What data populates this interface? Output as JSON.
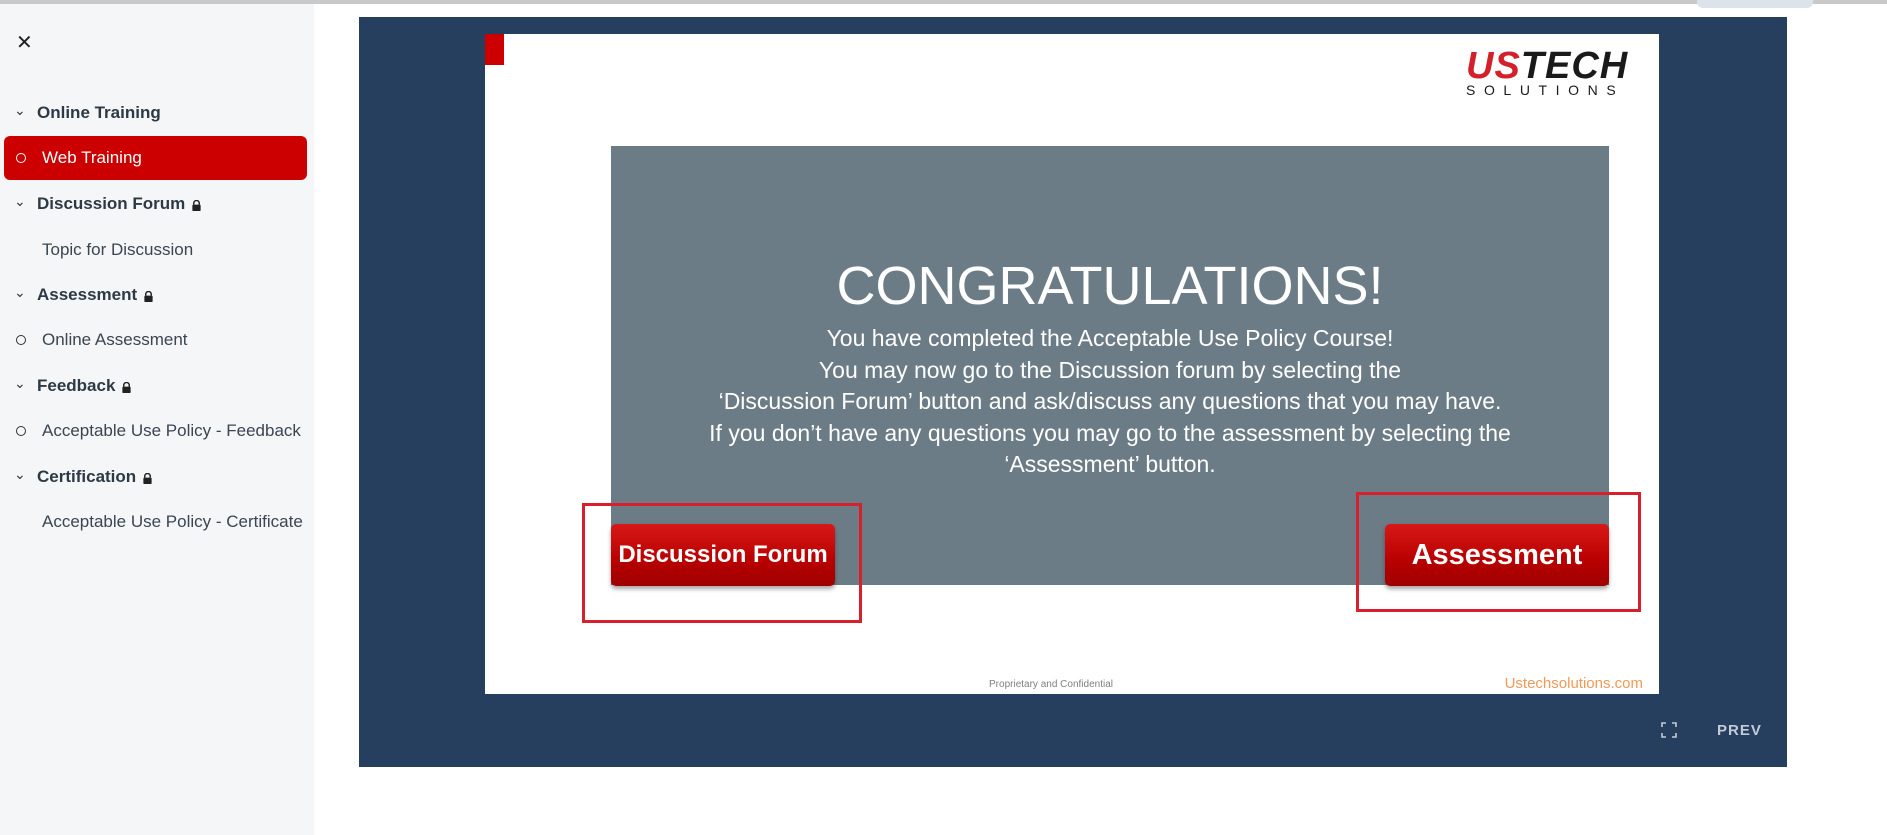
{
  "sidebar": {
    "close_glyph": "✕",
    "sections": [
      {
        "label": "Online Training",
        "locked": false
      },
      {
        "label": "Discussion Forum",
        "locked": true
      },
      {
        "label": "Assessment",
        "locked": true
      },
      {
        "label": "Feedback",
        "locked": true
      },
      {
        "label": "Certification",
        "locked": true
      }
    ],
    "items": [
      {
        "label": "Web Training",
        "active": true
      },
      {
        "label": "Topic for Discussion"
      },
      {
        "label": "Online Assessment"
      },
      {
        "label": "Acceptable Use Policy - Feedback"
      },
      {
        "label": "Acceptable Use Policy - Certificate"
      }
    ]
  },
  "slide": {
    "logo": {
      "us": "US",
      "tech": "TECH",
      "sub": "SOLUTIONS"
    },
    "heading": "CONGRATULATIONS!",
    "lines": [
      "You have completed the Acceptable Use Policy  Course!",
      "You may now go to the Discussion forum by selecting the",
      "‘Discussion Forum’ button and ask/discuss any questions that you may have.",
      "If you don’t have any questions you may go to the assessment by selecting the",
      "‘Assessment’ button."
    ],
    "discussion_button": "Discussion Forum",
    "assessment_button": "Assessment",
    "footer_confidential": "Proprietary and Confidential",
    "footer_url": "Ustechsolutions.com"
  },
  "player": {
    "prev_label": "PREV"
  },
  "colors": {
    "accent": "#cc0000",
    "player_bg": "#273f5f",
    "panel_bg": "#6c7c86",
    "highlight": "#d81f2c"
  }
}
